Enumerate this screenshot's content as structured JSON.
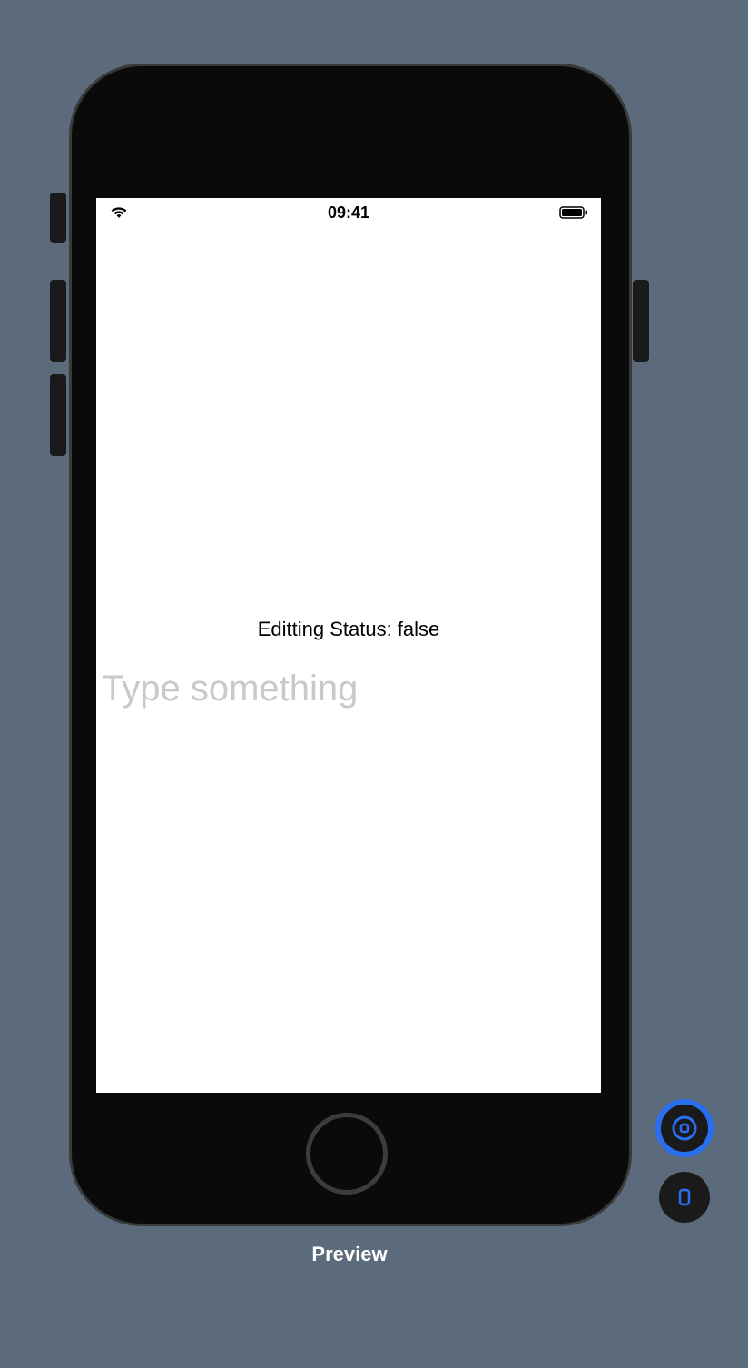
{
  "status_bar": {
    "time": "09:41"
  },
  "content": {
    "status_text": "Editting Status: false",
    "input_placeholder": "Type something",
    "input_value": ""
  },
  "footer": {
    "label": "Preview"
  }
}
